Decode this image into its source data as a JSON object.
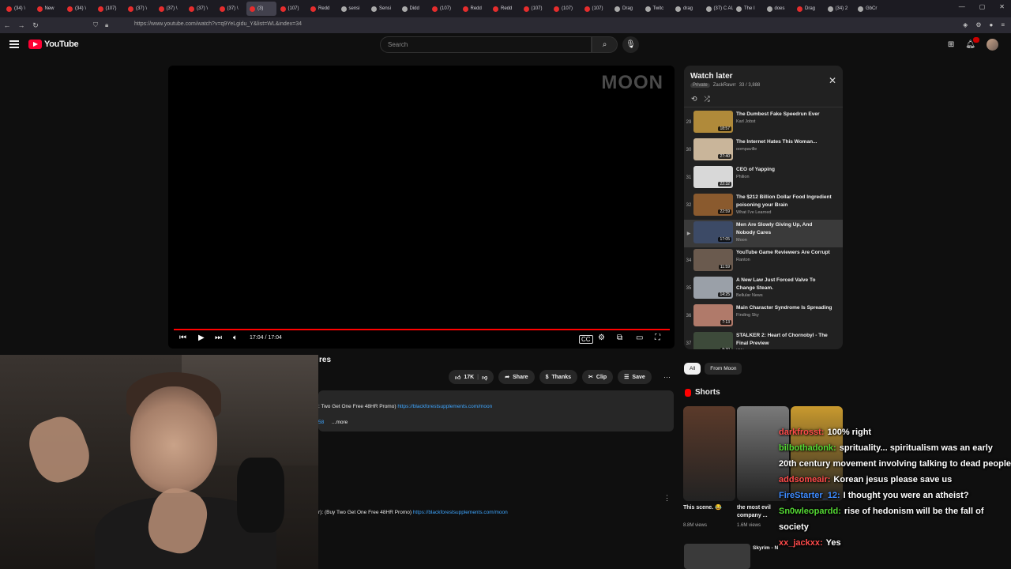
{
  "browser": {
    "tabs": [
      {
        "label": "(34) \\",
        "fav": "red"
      },
      {
        "label": "New",
        "fav": "red"
      },
      {
        "label": "(34) \\",
        "fav": "red"
      },
      {
        "label": "(107)",
        "fav": "red"
      },
      {
        "label": "(37) \\",
        "fav": "red"
      },
      {
        "label": "(37) \\",
        "fav": "red"
      },
      {
        "label": "(37) \\",
        "fav": "red"
      },
      {
        "label": "(37) \\",
        "fav": "red"
      },
      {
        "label": "(3)",
        "fav": "red",
        "active": true
      },
      {
        "label": "(107)",
        "fav": "red"
      },
      {
        "label": "Redd",
        "fav": "red"
      },
      {
        "label": "sensi",
        "fav": "gray"
      },
      {
        "label": "Sensi",
        "fav": "gray"
      },
      {
        "label": "Didd",
        "fav": "gray"
      },
      {
        "label": "(107)",
        "fav": "red"
      },
      {
        "label": "Redd",
        "fav": "red"
      },
      {
        "label": "Redd",
        "fav": "red"
      },
      {
        "label": "(107)",
        "fav": "red"
      },
      {
        "label": "(107)",
        "fav": "red"
      },
      {
        "label": "(107)",
        "fav": "red"
      },
      {
        "label": "Drag",
        "fav": "gray"
      },
      {
        "label": "Twitc",
        "fav": "gray"
      },
      {
        "label": "drag",
        "fav": "gray"
      },
      {
        "label": "(37) C AUTOM",
        "fav": "gray"
      },
      {
        "label": "The I",
        "fav": "gray"
      },
      {
        "label": "does",
        "fav": "gray"
      },
      {
        "label": "Drag",
        "fav": "red"
      },
      {
        "label": "(34) 2",
        "fav": "gray"
      },
      {
        "label": "GbCr",
        "fav": "gray"
      }
    ],
    "url": "https://www.youtube.com/watch?v=q9YeLgidu_Y&list=WL&index=34"
  },
  "youtube": {
    "logo": "YouTube",
    "search_placeholder": "Search"
  },
  "player": {
    "watermark": "MOON",
    "time": "17:04 / 17:04",
    "progress": 1.0
  },
  "playlist": {
    "title": "Watch later",
    "privacy": "Private",
    "owner": "ZackRawrr",
    "position": "33 / 3,888",
    "items": [
      {
        "num": "29",
        "title": "The Dumbest Fake Speedrun Ever",
        "channel": "Karl Jobst",
        "duration": "18:57",
        "thumb": "#b08a3a"
      },
      {
        "num": "30",
        "title": "The Internet Hates This Woman...",
        "channel": "oompaville",
        "duration": "27:40",
        "thumb": "#c9b59a"
      },
      {
        "num": "31",
        "title": "CEO of Yapping",
        "channel": "Philion",
        "duration": "22:32",
        "thumb": "#d8d8d8"
      },
      {
        "num": "32",
        "title": "The $212 Billion Dollar Food Ingredient poisoning your Brain",
        "channel": "What I've Learned",
        "duration": "22:59",
        "thumb": "#8a5a2e"
      },
      {
        "num": "▶",
        "title": "Men Are Slowly Giving Up, And Nobody Cares",
        "channel": "Moon",
        "duration": "17:05",
        "thumb": "#3c4a66",
        "current": true
      },
      {
        "num": "34",
        "title": "YouTube Game Reviewers Are Corrupt",
        "channel": "Ranton",
        "duration": "11:59",
        "thumb": "#6a5a4e"
      },
      {
        "num": "35",
        "title": "A New Law Just Forced Valve To Change Steam.",
        "channel": "Bellular News",
        "duration": "14:25",
        "thumb": "#9aa0a8"
      },
      {
        "num": "36",
        "title": "Main Character Syndrome Is Spreading",
        "channel": "Finding Sky",
        "duration": "7:13",
        "thumb": "#b07a6a"
      },
      {
        "num": "37",
        "title": "STALKER 2: Heart of Chornobyl - The Final Preview",
        "channel": "IGN",
        "duration": "8:30",
        "thumb": "#3d4a3a"
      }
    ]
  },
  "video": {
    "title_fragment": "res",
    "likes": "17K",
    "share": "Share",
    "thanks": "Thanks",
    "clip": "Clip",
    "save": "Save",
    "desc_text": ": Two Get One Free 48HR Promo)",
    "desc_link": "https://blackforestsupplements.com/moon",
    "desc_ts": "58",
    "desc_more": "...more",
    "comment_text": "r): (Buy Two Get One Free 48HR Promo)",
    "comment_link": "https://blackforestsupplements.com/moon"
  },
  "side": {
    "chip_all": "All",
    "chip_from": "From Moon",
    "shorts_title": "Shorts",
    "shorts": [
      {
        "title": "This scene. 😂",
        "views": "8.8M views",
        "color": "#5b3a2a"
      },
      {
        "title": "the most evil company ...",
        "views": "1.6M views",
        "color": "#7a7a7a"
      },
      {
        "title": "",
        "views": "",
        "color": "#c99a2e"
      }
    ],
    "next_title": "Skyrim - N"
  },
  "chat": [
    {
      "user": "darkfrosst:",
      "msg": "100% right",
      "color": "#ff4b4b"
    },
    {
      "user": "bilbothadonk:",
      "msg": "sprituality... spiritualism was an early 20th century movement involving talking to dead people",
      "color": "#54d833"
    },
    {
      "user": "addsomeair:",
      "msg": "Korean jesus please save us",
      "color": "#ff4b4b"
    },
    {
      "user": "FireStarter_12:",
      "msg": "I thought you were an atheist?",
      "color": "#3d8bff"
    },
    {
      "user": "Sn0wleopardd:",
      "msg": "rise of hedonism will be the fall of society",
      "color": "#54d833"
    },
    {
      "user": "xx_jackxx:",
      "msg": "Yes",
      "color": "#ff4b4b"
    }
  ]
}
